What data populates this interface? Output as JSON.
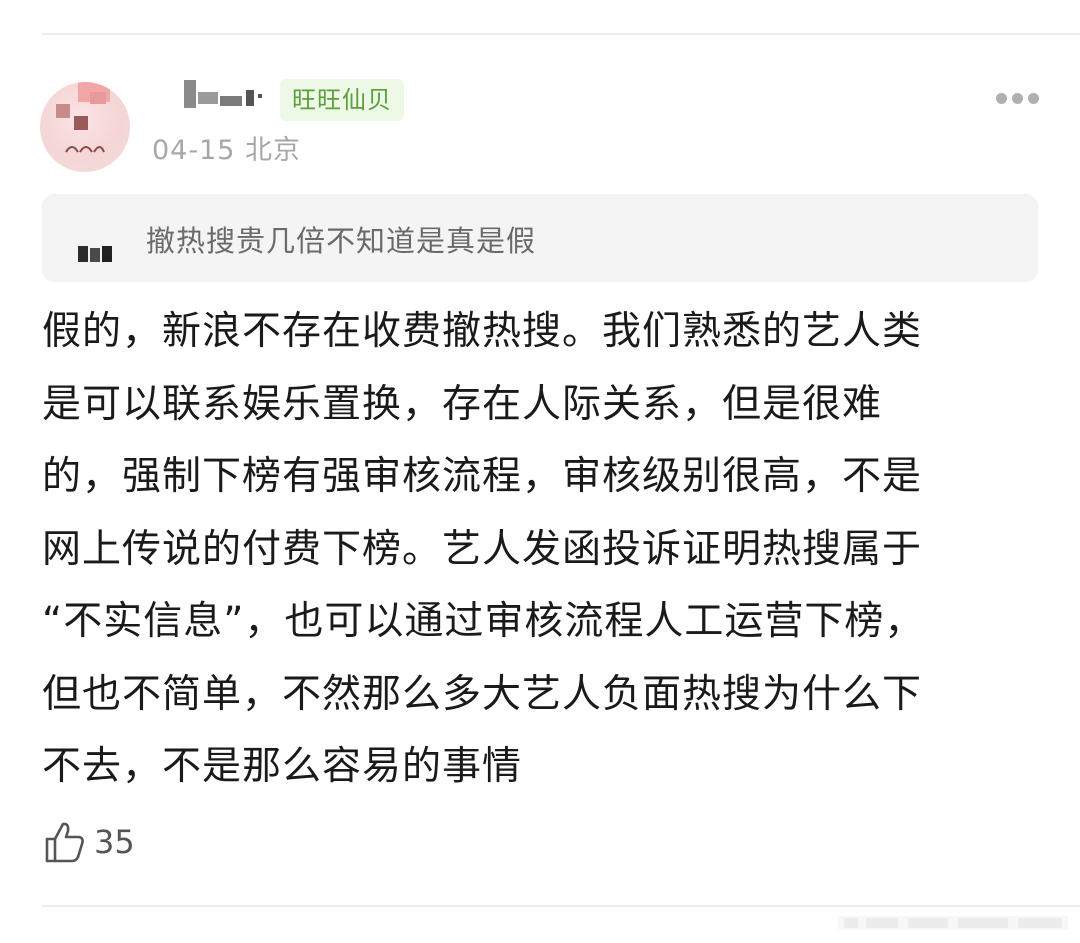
{
  "user": {
    "badge": "旺旺仙贝",
    "meta": "04-15 北京"
  },
  "quote": {
    "text": "撤热搜贵几倍不知道是真是假"
  },
  "comment": {
    "lines": [
      "假的，新浪不存在收费撤热搜。我们熟悉的艺人类",
      "是可以联系娱乐置换，存在人际关系，但是很难",
      "的，强制下榜有强审核流程，审核级别很高，不是",
      "网上传说的付费下榜。艺人发函投诉证明热搜属于",
      "“不实信息”，也可以通过审核流程人工运营下榜，",
      "但也不简单，不然那么多大艺人负面热搜为什么下",
      "不去，不是那么容易的事情"
    ]
  },
  "actions": {
    "like_icon": "thumbs-up-icon",
    "like_count": "35",
    "more_icon": "more-dots-icon"
  },
  "colors": {
    "badge_bg": "#eef8e6",
    "badge_text": "#5ba03a",
    "meta_text": "#a7a7a7",
    "quote_bg": "#f4f4f4"
  }
}
